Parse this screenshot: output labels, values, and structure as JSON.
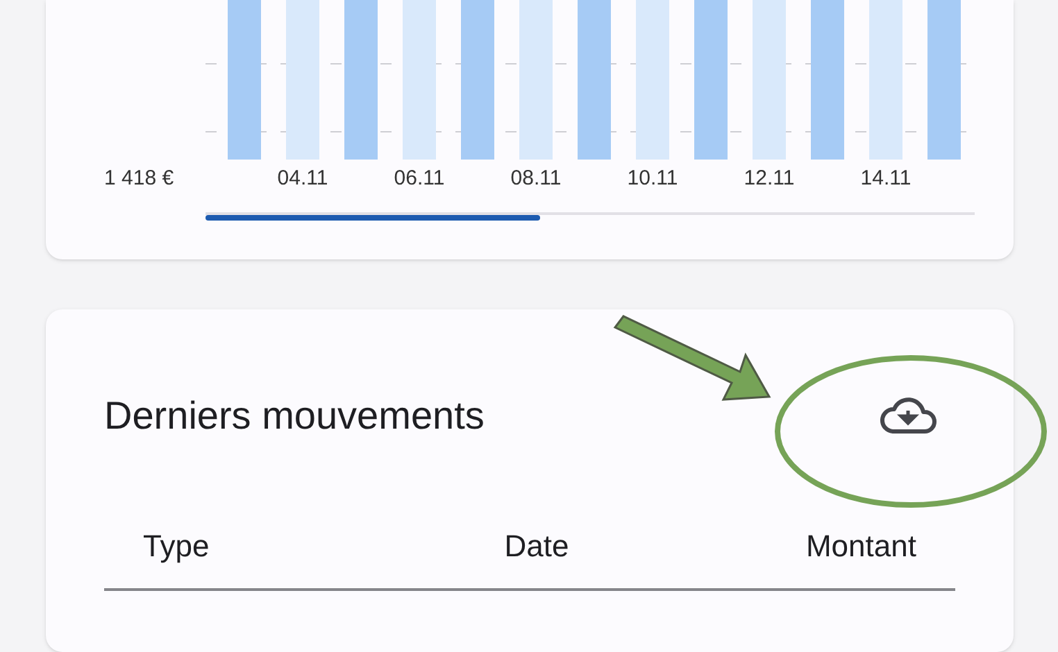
{
  "chart": {
    "axis_label": "1 418 €",
    "x_labels": [
      "04.11",
      "06.11",
      "08.11",
      "10.11",
      "12.11",
      "14.11"
    ]
  },
  "movements": {
    "title": "Derniers mouvements",
    "columns": [
      "Type",
      "Date",
      "Montant"
    ]
  }
}
